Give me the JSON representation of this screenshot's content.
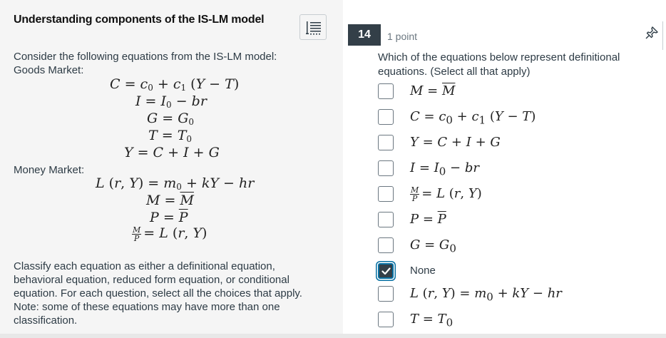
{
  "left_panel": {
    "title": "Understanding components of the IS-LM model",
    "intro": "Consider the following equations from the IS-LM model:",
    "goods_label": "Goods Market:",
    "money_label": "Money Market:",
    "classify_text": "Classify each equation as either a definitional equation, behavioral equation, reduced form equation, or conditional equation. For each question, select all the choices that apply. Note: some of these equations may have more than one classification."
  },
  "question": {
    "number": "14",
    "points": "1 point",
    "text": "Which of the equations below represent definitional equations. (Select all that apply)"
  },
  "options": [
    {
      "id": "m-eq-mbar",
      "checked": false
    },
    {
      "id": "consumption",
      "checked": false
    },
    {
      "id": "y-identity",
      "checked": false
    },
    {
      "id": "investment",
      "checked": false
    },
    {
      "id": "money-demand-ratio",
      "checked": false
    },
    {
      "id": "p-eq-pbar",
      "checked": false
    },
    {
      "id": "g-eq-g0",
      "checked": false
    },
    {
      "id": "none",
      "label": "None",
      "checked": true
    },
    {
      "id": "liquidity",
      "checked": false
    },
    {
      "id": "t-eq-t0",
      "checked": false
    }
  ],
  "colors": {
    "left_bg": "#f5f5f5",
    "badge_bg": "#333f48",
    "focus_ring": "#0770a3"
  },
  "icons": {
    "toc": "list-icon",
    "pin": "pin-icon",
    "check": "checkmark-icon"
  }
}
